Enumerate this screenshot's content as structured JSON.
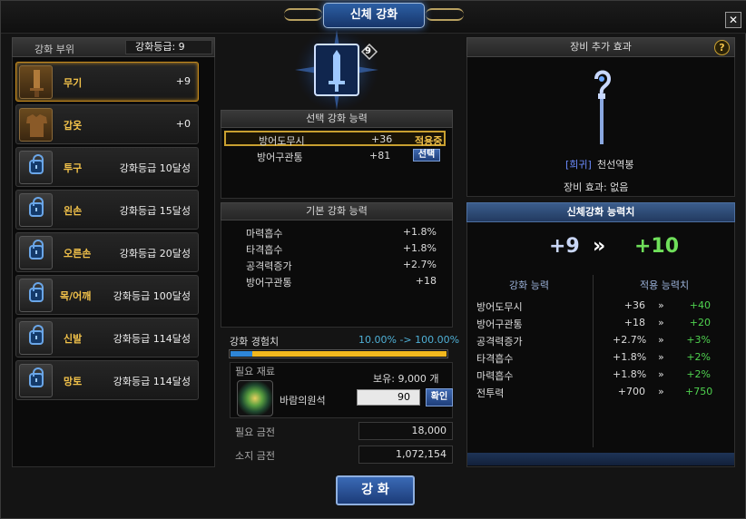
{
  "title": "신체 강화",
  "left_panel": {
    "header": "강화 부위",
    "grade_label": "강화등급: 9",
    "slots": [
      {
        "name": "무기",
        "value": "+9"
      },
      {
        "name": "갑옷",
        "value": "+0"
      },
      {
        "name": "투구",
        "value": "강화등급 10달성"
      },
      {
        "name": "왼손",
        "value": "강화등급 15달성"
      },
      {
        "name": "오른손",
        "value": "강화등급 20달성"
      },
      {
        "name": "목/어깨",
        "value": "강화등급 100달성"
      },
      {
        "name": "신발",
        "value": "강화등급 114달성"
      },
      {
        "name": "망토",
        "value": "강화등급 114달성"
      }
    ]
  },
  "center": {
    "emblem_level": "9",
    "selected_header": "선택 강화 능력",
    "selected_rows": [
      {
        "name": "방어도무시",
        "value": "+36",
        "action": "적용중"
      },
      {
        "name": "방어구관통",
        "value": "+81",
        "action": "선택"
      }
    ],
    "base_header": "기본 강화 능력",
    "base_rows": [
      {
        "name": "마력흡수",
        "value": "+1.8%"
      },
      {
        "name": "타격흡수",
        "value": "+1.8%"
      },
      {
        "name": "공격력증가",
        "value": "+2.7%"
      },
      {
        "name": "방어구관통",
        "value": "+18"
      }
    ],
    "exp_label": "강화 경험치",
    "exp_value": "10.00% -> 100.00%",
    "exp_current": 0.1,
    "exp_after": 1.0,
    "material_label": "필요 재료",
    "owned": "보유: 9,000 개",
    "material_name": "바람의원석",
    "material_qty": "90",
    "confirm_label": "확인",
    "cost_label": "필요 금전",
    "cost_value": "18,000",
    "gold_label": "소지 금전",
    "gold_value": "1,072,154"
  },
  "enhance_button": "강 화",
  "right_panel": {
    "header": "장비 추가 효과",
    "help": "?",
    "item_rarity": "[희귀]",
    "item_name": "천선역봉",
    "effect_label": "장비 효과: 없음",
    "stat_header": "신체강화 능력치",
    "level_from": "+9",
    "level_to": "+10",
    "col_ability": "강화 능력",
    "col_applied": "적용 능력치",
    "stats": [
      {
        "name": "방어도무시",
        "from": "+36",
        "to": "+40"
      },
      {
        "name": "방어구관통",
        "from": "+18",
        "to": "+20"
      },
      {
        "name": "공격력증가",
        "from": "+2.7%",
        "to": "+3%"
      },
      {
        "name": "타격흡수",
        "from": "+1.8%",
        "to": "+2%"
      },
      {
        "name": "마력흡수",
        "from": "+1.8%",
        "to": "+2%"
      },
      {
        "name": "전투력",
        "from": "+700",
        "to": "+750"
      }
    ]
  },
  "colors": {
    "accent_gold": "#f2c24a",
    "accent_blue": "#2e86d8",
    "positive_green": "#4fd24f"
  }
}
